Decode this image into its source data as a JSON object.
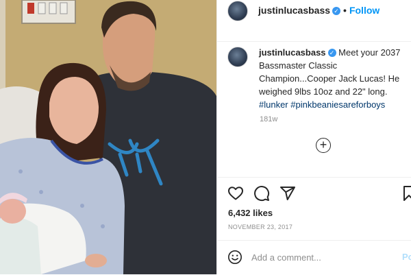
{
  "post": {
    "username": "justinlucasbass",
    "follow_label": "Follow",
    "separator": "•",
    "verified_glyph": "✓",
    "caption": {
      "text": "Meet your 2037 Bassmaster Classic Champion...Cooper Jack Lucas! He weighed 9lbs 10oz and 22\" long.",
      "hashtags": [
        "#lunker",
        "#pinkbeaniesareforboys"
      ]
    },
    "time_ago": "181w",
    "load_more_glyph": "+",
    "likes": "6,432 likes",
    "date": "NOVEMBER 23, 2017",
    "comment": {
      "placeholder": "Add a comment...",
      "post_label": "Post"
    }
  },
  "icons": {
    "like": "heart-icon",
    "comment": "comment-icon",
    "share": "share-icon",
    "emoji": "emoji-icon",
    "load_more": "plus-circle-icon"
  },
  "colors": {
    "accent": "#0095f6",
    "verified": "#3897f0",
    "hashtag": "#00376b",
    "muted": "#8e8e8e",
    "text": "#262626"
  }
}
